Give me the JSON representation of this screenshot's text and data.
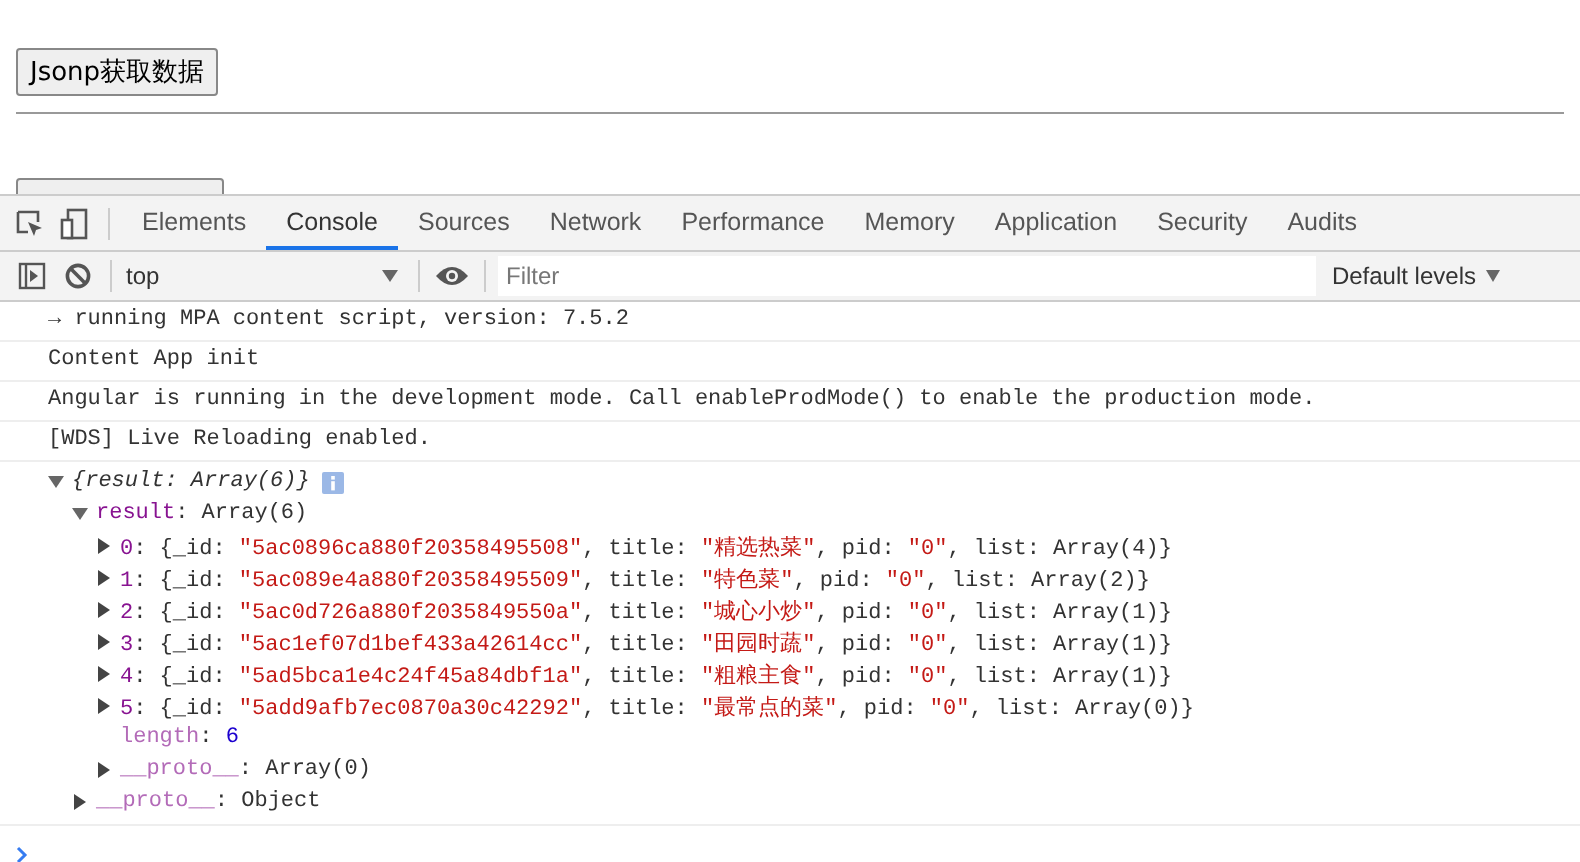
{
  "page": {
    "buttons": [
      {
        "label": "Jsonp获取数据",
        "kind": "full"
      },
      {
        "kind": "clipped"
      }
    ]
  },
  "devtools": {
    "tabs": [
      {
        "label": "Elements",
        "selected": false
      },
      {
        "label": "Console",
        "selected": true
      },
      {
        "label": "Sources",
        "selected": false
      },
      {
        "label": "Network",
        "selected": false
      },
      {
        "label": "Performance",
        "selected": false
      },
      {
        "label": "Memory",
        "selected": false
      },
      {
        "label": "Application",
        "selected": false
      },
      {
        "label": "Security",
        "selected": false
      },
      {
        "label": "Audits",
        "selected": false
      }
    ],
    "toolbar": {
      "context": "top",
      "filter_placeholder": "Filter",
      "levels": "Default levels"
    },
    "console": {
      "messages": [
        {
          "text": "→ running MPA content script, version: 7.5.2"
        },
        {
          "text": "Content App init"
        },
        {
          "text": "Angular is running in the development mode. Call enableProdMode() to enable the production mode."
        },
        {
          "text": "[WDS] Live Reloading enabled."
        }
      ],
      "tree": {
        "segments": [
          {
            "text": "{result: Array(6)}",
            "kind": "italic"
          }
        ],
        "info": true,
        "expanded": true,
        "children": [
          {
            "segments": [
              {
                "text": "result",
                "kind": "key"
              },
              {
                "text": ": Array(6)",
                "kind": "plain"
              }
            ],
            "expanded": true,
            "children": [
              {
                "segments": [
                  {
                    "text": "0",
                    "kind": "key"
                  },
                  {
                    "text": ": {_id: ",
                    "kind": "plain"
                  },
                  {
                    "text": "\"5ac0896ca880f20358495508\"",
                    "kind": "string"
                  },
                  {
                    "text": ", title: ",
                    "kind": "plain"
                  },
                  {
                    "text": "\"精选热菜\"",
                    "kind": "string"
                  },
                  {
                    "text": ", pid: ",
                    "kind": "plain"
                  },
                  {
                    "text": "\"0\"",
                    "kind": "string"
                  },
                  {
                    "text": ", list: Array(4)}",
                    "kind": "plain"
                  }
                ],
                "expanded": false
              },
              {
                "segments": [
                  {
                    "text": "1",
                    "kind": "key"
                  },
                  {
                    "text": ": {_id: ",
                    "kind": "plain"
                  },
                  {
                    "text": "\"5ac089e4a880f20358495509\"",
                    "kind": "string"
                  },
                  {
                    "text": ", title: ",
                    "kind": "plain"
                  },
                  {
                    "text": "\"特色菜\"",
                    "kind": "string"
                  },
                  {
                    "text": ", pid: ",
                    "kind": "plain"
                  },
                  {
                    "text": "\"0\"",
                    "kind": "string"
                  },
                  {
                    "text": ", list: Array(2)}",
                    "kind": "plain"
                  }
                ],
                "expanded": false
              },
              {
                "segments": [
                  {
                    "text": "2",
                    "kind": "key"
                  },
                  {
                    "text": ": {_id: ",
                    "kind": "plain"
                  },
                  {
                    "text": "\"5ac0d726a880f2035849550a\"",
                    "kind": "string"
                  },
                  {
                    "text": ", title: ",
                    "kind": "plain"
                  },
                  {
                    "text": "\"城心小炒\"",
                    "kind": "string"
                  },
                  {
                    "text": ", pid: ",
                    "kind": "plain"
                  },
                  {
                    "text": "\"0\"",
                    "kind": "string"
                  },
                  {
                    "text": ", list: Array(1)}",
                    "kind": "plain"
                  }
                ],
                "expanded": false
              },
              {
                "segments": [
                  {
                    "text": "3",
                    "kind": "key"
                  },
                  {
                    "text": ": {_id: ",
                    "kind": "plain"
                  },
                  {
                    "text": "\"5ac1ef07d1bef433a42614cc\"",
                    "kind": "string"
                  },
                  {
                    "text": ", title: ",
                    "kind": "plain"
                  },
                  {
                    "text": "\"田园时蔬\"",
                    "kind": "string"
                  },
                  {
                    "text": ", pid: ",
                    "kind": "plain"
                  },
                  {
                    "text": "\"0\"",
                    "kind": "string"
                  },
                  {
                    "text": ", list: Array(1)}",
                    "kind": "plain"
                  }
                ],
                "expanded": false
              },
              {
                "segments": [
                  {
                    "text": "4",
                    "kind": "key"
                  },
                  {
                    "text": ": {_id: ",
                    "kind": "plain"
                  },
                  {
                    "text": "\"5ad5bca1e4c24f45a84dbf1a\"",
                    "kind": "string"
                  },
                  {
                    "text": ", title: ",
                    "kind": "plain"
                  },
                  {
                    "text": "\"粗粮主食\"",
                    "kind": "string"
                  },
                  {
                    "text": ", pid: ",
                    "kind": "plain"
                  },
                  {
                    "text": "\"0\"",
                    "kind": "string"
                  },
                  {
                    "text": ", list: Array(1)}",
                    "kind": "plain"
                  }
                ],
                "expanded": false
              },
              {
                "segments": [
                  {
                    "text": "5",
                    "kind": "key"
                  },
                  {
                    "text": ": {_id: ",
                    "kind": "plain"
                  },
                  {
                    "text": "\"5add9afb7ec0870a30c42292\"",
                    "kind": "string"
                  },
                  {
                    "text": ", title: ",
                    "kind": "plain"
                  },
                  {
                    "text": "\"最常点的菜\"",
                    "kind": "string"
                  },
                  {
                    "text": ", pid: ",
                    "kind": "plain"
                  },
                  {
                    "text": "\"0\"",
                    "kind": "string"
                  },
                  {
                    "text": ", list: Array(0)}",
                    "kind": "plain"
                  }
                ],
                "expanded": false
              },
              {
                "segments": [
                  {
                    "text": "length",
                    "kind": "dimkey"
                  },
                  {
                    "text": ": ",
                    "kind": "plain"
                  },
                  {
                    "text": "6",
                    "kind": "number"
                  }
                ]
              },
              {
                "segments": [
                  {
                    "text": "__proto__",
                    "kind": "dimkey"
                  },
                  {
                    "text": ": Array(0)",
                    "kind": "plain"
                  }
                ],
                "expanded": false
              }
            ]
          },
          {
            "segments": [
              {
                "text": "__proto__",
                "kind": "dimkey"
              },
              {
                "text": ": Object",
                "kind": "plain"
              }
            ],
            "expanded": false
          }
        ]
      }
    }
  }
}
